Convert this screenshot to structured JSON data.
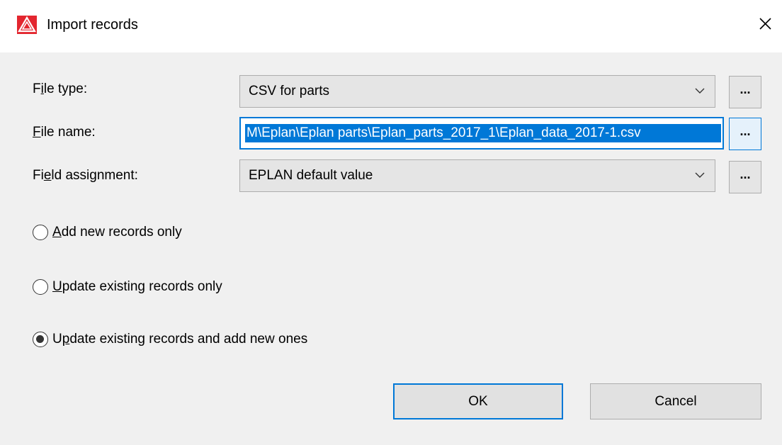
{
  "window": {
    "title": "Import records",
    "app_icon": "eplan-warning-icon",
    "close_icon": "close-icon"
  },
  "form": {
    "file_type": {
      "label_pre": "F",
      "label_u": "i",
      "label_post": "le type:",
      "value": "CSV for parts",
      "browse": "..."
    },
    "file_name": {
      "label_pre": "",
      "label_u": "F",
      "label_post": "ile name:",
      "value": "M\\Eplan\\Eplan parts\\Eplan_parts_2017_1\\Eplan_data_2017-1.csv",
      "browse": "..."
    },
    "field_assignment": {
      "label_pre": "Fi",
      "label_u": "e",
      "label_post": "ld assignment:",
      "value": "EPLAN default value",
      "browse": "..."
    }
  },
  "options": [
    {
      "pre": "",
      "u": "A",
      "post": "dd new records only",
      "checked": false
    },
    {
      "pre": "",
      "u": "U",
      "post": "pdate existing records only",
      "checked": false
    },
    {
      "pre": "U",
      "u": "p",
      "post": "date existing records and add new ones",
      "checked": true
    }
  ],
  "buttons": {
    "ok": "OK",
    "cancel": "Cancel"
  },
  "colors": {
    "accent": "#0078d7",
    "icon_red": "#e3262f"
  }
}
